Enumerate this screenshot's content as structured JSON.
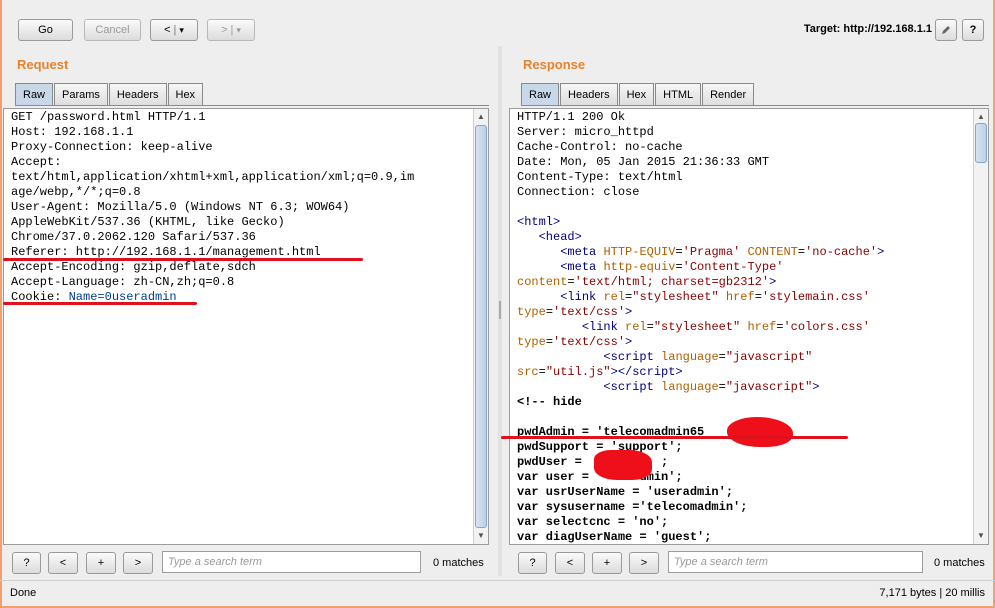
{
  "toolbar": {
    "go_label": "Go",
    "cancel_label": "Cancel",
    "back_label": "<",
    "forward_label": ">",
    "dropdown_glyph": "▾",
    "target_label": "Target: http://192.168.1.1"
  },
  "request": {
    "title": "Request",
    "tabs": [
      "Raw",
      "Params",
      "Headers",
      "Hex"
    ],
    "lines": {
      "l1": "GET /password.html HTTP/1.1",
      "l2": "Host: 192.168.1.1",
      "l3": "Proxy-Connection: keep-alive",
      "l4": "Accept:",
      "l5": "text/html,application/xhtml+xml,application/xml;q=0.9,im",
      "l6": "age/webp,*/*;q=0.8",
      "l7": "User-Agent: Mozilla/5.0 (Windows NT 6.3; WOW64)",
      "l8": "AppleWebKit/537.36 (KHTML, like Gecko)",
      "l9": "Chrome/37.0.2062.120 Safari/537.36",
      "l10": "Referer: http://192.168.1.1/management.html",
      "l11": "Accept-Encoding: gzip,deflate,sdch",
      "l12": "Accept-Language: zh-CN,zh;q=0.8",
      "cookie_key": "Cookie: ",
      "cookie_val": "Name=0useradmin"
    },
    "search_placeholder": "Type a search term",
    "matches": "0 matches"
  },
  "response": {
    "title": "Response",
    "tabs": [
      "Raw",
      "Headers",
      "Hex",
      "HTML",
      "Render"
    ],
    "lines": {
      "h1": "HTTP/1.1 200 Ok",
      "h2": "Server: micro_httpd",
      "h3": "Cache-Control: no-cache",
      "h4": "Date: Mon, 05 Jan 2015 21:36:33 GMT",
      "h5": "Content-Type: text/html",
      "h6": "Connection: close",
      "hide": "<!-- hide",
      "pwd_admin": "pwdAdmin = 'telecomadmin65",
      "pwd_support": "pwdSupport = 'support';",
      "pwd_user": "pwdUser = ",
      "pwd_user_end": ";",
      "var_user": "var user = ",
      "var_user_end": "dmin';",
      "usr_user_name": "var usrUserName = 'useradmin';",
      "sysusername": "var sysusername ='telecomadmin';",
      "selectcnc": "var selectcnc = 'no';",
      "diag": "var diagUserName = 'guest';"
    },
    "search_placeholder": "Type a search term",
    "matches": "0 matches"
  },
  "status": {
    "left": "Done",
    "right": "7,171 bytes | 20 millis"
  },
  "icons": [
    "pencil-icon",
    "help-icon"
  ],
  "colors": {
    "section_title": "#e8822c",
    "redaction": "#e0101c",
    "active_tab": "#c8d8e8"
  }
}
